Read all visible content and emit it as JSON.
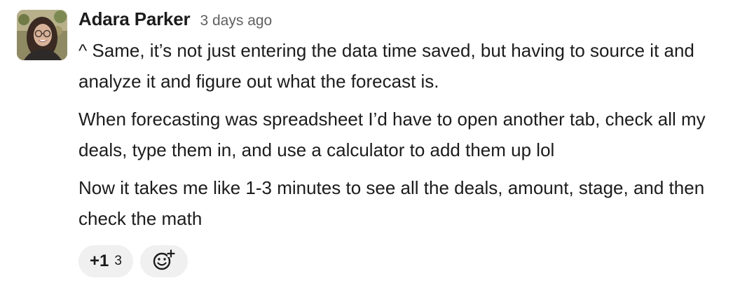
{
  "message": {
    "author": "Adara Parker",
    "timestamp": "3 days ago",
    "paragraphs": [
      "^ Same, it’s not just entering the data time saved, but having to source it and analyze it and figure out what the forecast is.",
      "When forecasting was spreadsheet I’d have to open another tab, check all my deals, type them in, and use a calculator to add them up lol",
      "Now it takes me like 1-3 minutes to see all the deals, amount, stage, and then check the math"
    ],
    "reactions": [
      {
        "emoji": "+1",
        "count": "3"
      }
    ],
    "add_reaction_icon": "add-emoji-icon"
  }
}
